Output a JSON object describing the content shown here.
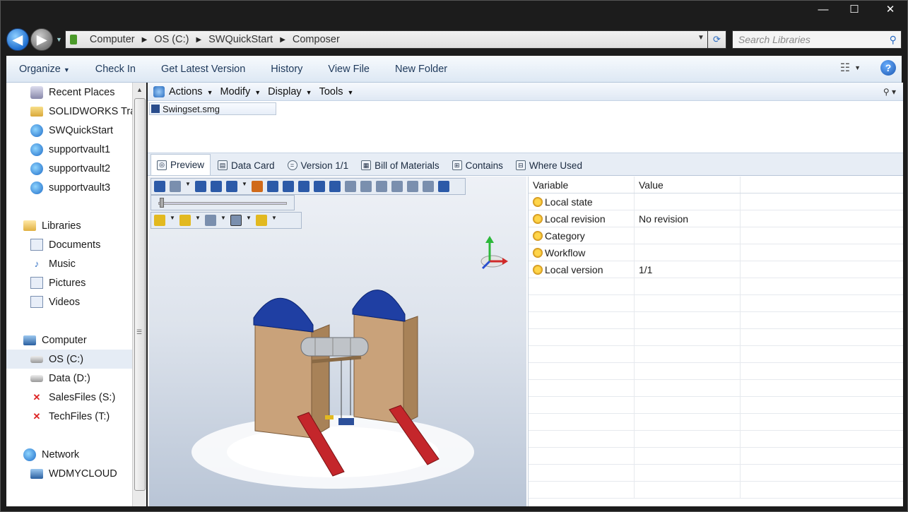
{
  "window": {
    "controls": {
      "minimize": "—",
      "maximize": "☐",
      "close": "✕"
    }
  },
  "address": {
    "crumbs": [
      "Computer",
      "OS (C:)",
      "SWQuickStart",
      "Composer"
    ]
  },
  "search": {
    "placeholder": "Search Libraries"
  },
  "toolbar": {
    "organize": "Organize",
    "check_in": "Check In",
    "get_latest": "Get Latest Version",
    "history": "History",
    "view_file": "View File",
    "new_folder": "New Folder"
  },
  "nav": {
    "favorites": [
      "Recent Places",
      "SOLIDWORKS Tra",
      "SWQuickStart",
      "supportvault1",
      "supportvault2",
      "supportvault3"
    ],
    "libraries": {
      "label": "Libraries",
      "items": [
        "Documents",
        "Music",
        "Pictures",
        "Videos"
      ]
    },
    "computer": {
      "label": "Computer",
      "items": [
        "OS (C:)",
        "Data (D:)",
        "SalesFiles (S:)",
        "TechFiles (T:)"
      ]
    },
    "network": {
      "label": "Network",
      "items": [
        "WDMYCLOUD"
      ]
    }
  },
  "pdm": {
    "menus": [
      "Actions",
      "Modify",
      "Display",
      "Tools"
    ],
    "file": "Swingset.smg"
  },
  "tabs": [
    "Preview",
    "Data Card",
    "Version 1/1",
    "Bill of Materials",
    "Contains",
    "Where Used"
  ],
  "props": {
    "headers": [
      "Variable",
      "Value"
    ],
    "rows": [
      {
        "variable": "Local state",
        "value": ""
      },
      {
        "variable": "Local revision",
        "value": "No revision"
      },
      {
        "variable": "Category",
        "value": ""
      },
      {
        "variable": "Workflow",
        "value": ""
      },
      {
        "variable": "Local version",
        "value": "1/1"
      }
    ]
  },
  "colors": {
    "accent": "#1e395b",
    "roof": "#1f3fa3",
    "slide": "#c4262b",
    "wood": "#c9a27a"
  }
}
